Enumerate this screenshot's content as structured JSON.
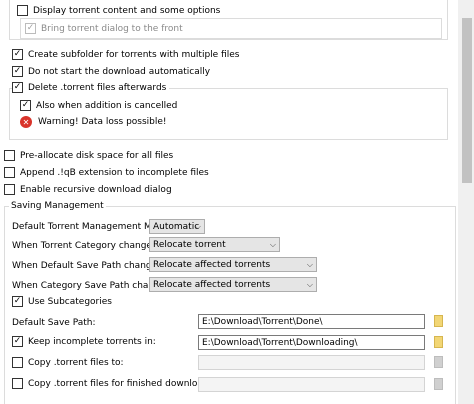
{
  "options": {
    "display_content": {
      "label": "Display torrent content and some options",
      "checked": false
    },
    "bring_front": {
      "label": "Bring torrent dialog to the front",
      "checked": true,
      "disabled": true
    },
    "create_subfolder": {
      "label": "Create subfolder for torrents with multiple files",
      "checked": true
    },
    "do_not_start": {
      "label": "Do not start the download automatically",
      "checked": true
    },
    "delete_torrent_files": {
      "label": "Delete .torrent files afterwards",
      "checked": true
    },
    "also_cancelled": {
      "label": "Also when addition is cancelled",
      "checked": true
    },
    "warning": "Warning! Data loss possible!",
    "preallocate": {
      "label": "Pre-allocate disk space for all files",
      "checked": false
    },
    "append_ext": {
      "label": "Append .!qB extension to incomplete files",
      "checked": false
    },
    "recursive_dialog": {
      "label": "Enable recursive download dialog",
      "checked": false
    }
  },
  "saving": {
    "group_title": "Saving Management",
    "mode_label": "Default Torrent Management Mode:",
    "mode_value": "Automatic",
    "category_changed_label": "When Torrent Category changed:",
    "category_changed_value": "Relocate torrent",
    "default_path_changed_label": "When Default Save Path changed:",
    "default_path_changed_value": "Relocate affected torrents",
    "category_path_changed_label": "When Category Save Path changed:",
    "category_path_changed_value": "Relocate affected torrents",
    "use_subcategories": {
      "label": "Use Subcategories",
      "checked": true
    },
    "default_save_path_label": "Default Save Path:",
    "default_save_path_value": "E:\\Download\\Torrent\\Done\\",
    "keep_incomplete": {
      "label": "Keep incomplete torrents in:",
      "checked": true
    },
    "keep_incomplete_value": "E:\\Download\\Torrent\\Downloading\\",
    "copy_torrent": {
      "label": "Copy .torrent files to:",
      "checked": false
    },
    "copy_finished": {
      "label": "Copy .torrent files for finished downloads to:",
      "checked": false
    }
  },
  "icons": {
    "check": "✓",
    "error": "✕",
    "arrow": "⌵"
  },
  "colors": {
    "error_red": "#d9342b",
    "folder": "#f2d675"
  }
}
